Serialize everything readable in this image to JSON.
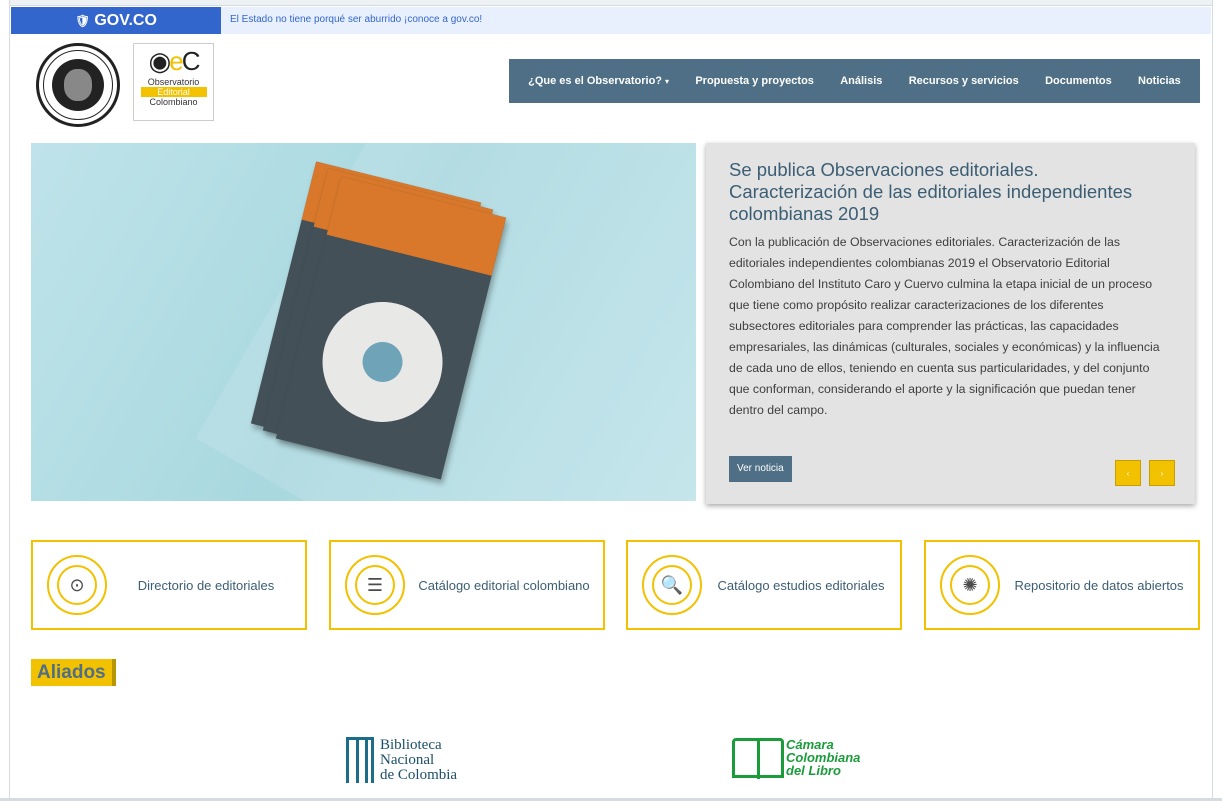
{
  "govbar": {
    "logo_text": "GOV.CO",
    "message": "El Estado no tiene porqué ser aburrido ¡conoce a gov.co!"
  },
  "header": {
    "oec_logo_line1": "Observatorio",
    "oec_logo_line2": "Editorial",
    "oec_logo_line3": "Colombiano"
  },
  "nav": {
    "items": [
      "¿Que es el Observatorio?",
      "Propuesta y proyectos",
      "Análisis",
      "Recursos y servicios",
      "Documentos",
      "Noticias"
    ]
  },
  "hero": {
    "title": "Se publica Observaciones editoriales. Caracterización de las editoriales independientes colombianas 2019",
    "body": "Con la publicación de Observaciones editoriales. Caracterización de las editoriales independientes colombianas 2019 el Observatorio Editorial Colombiano del Instituto Caro y Cuervo culmina la etapa inicial de un proceso que tiene como propósito realizar caracterizaciones de los diferentes subsectores editoriales para comprender las prácticas, las capacidades empresariales, las dinámicas (culturales, sociales y económicas) y la influencia de cada uno de ellos, teniendo en cuenta sus particularidades, y del conjunto que conforman, considerando el aporte y la significación que puedan tener dentro del campo.",
    "button": "Ver noticia",
    "prev": "‹",
    "next": "›"
  },
  "features": [
    {
      "label": "Directorio de editoriales",
      "icon": "target-icon"
    },
    {
      "label": "Catálogo editorial colombiano",
      "icon": "archive-icon"
    },
    {
      "label": "Catálogo estudios editoriales",
      "icon": "document-search-icon"
    },
    {
      "label": "Repositorio de datos abiertos",
      "icon": "network-icon"
    }
  ],
  "aliados": {
    "title": "Aliados",
    "bnc_line1": "Biblioteca",
    "bnc_line2": "Nacional",
    "bnc_line3": "de Colombia",
    "ccl_line1": "Cámara",
    "ccl_line2": "Colombiana",
    "ccl_line3": "del Libro"
  },
  "colors": {
    "gov_blue": "#3366cc",
    "nav_bg": "#4e6f85",
    "accent_yellow": "#f2c100",
    "title_blue": "#3c5e74"
  }
}
